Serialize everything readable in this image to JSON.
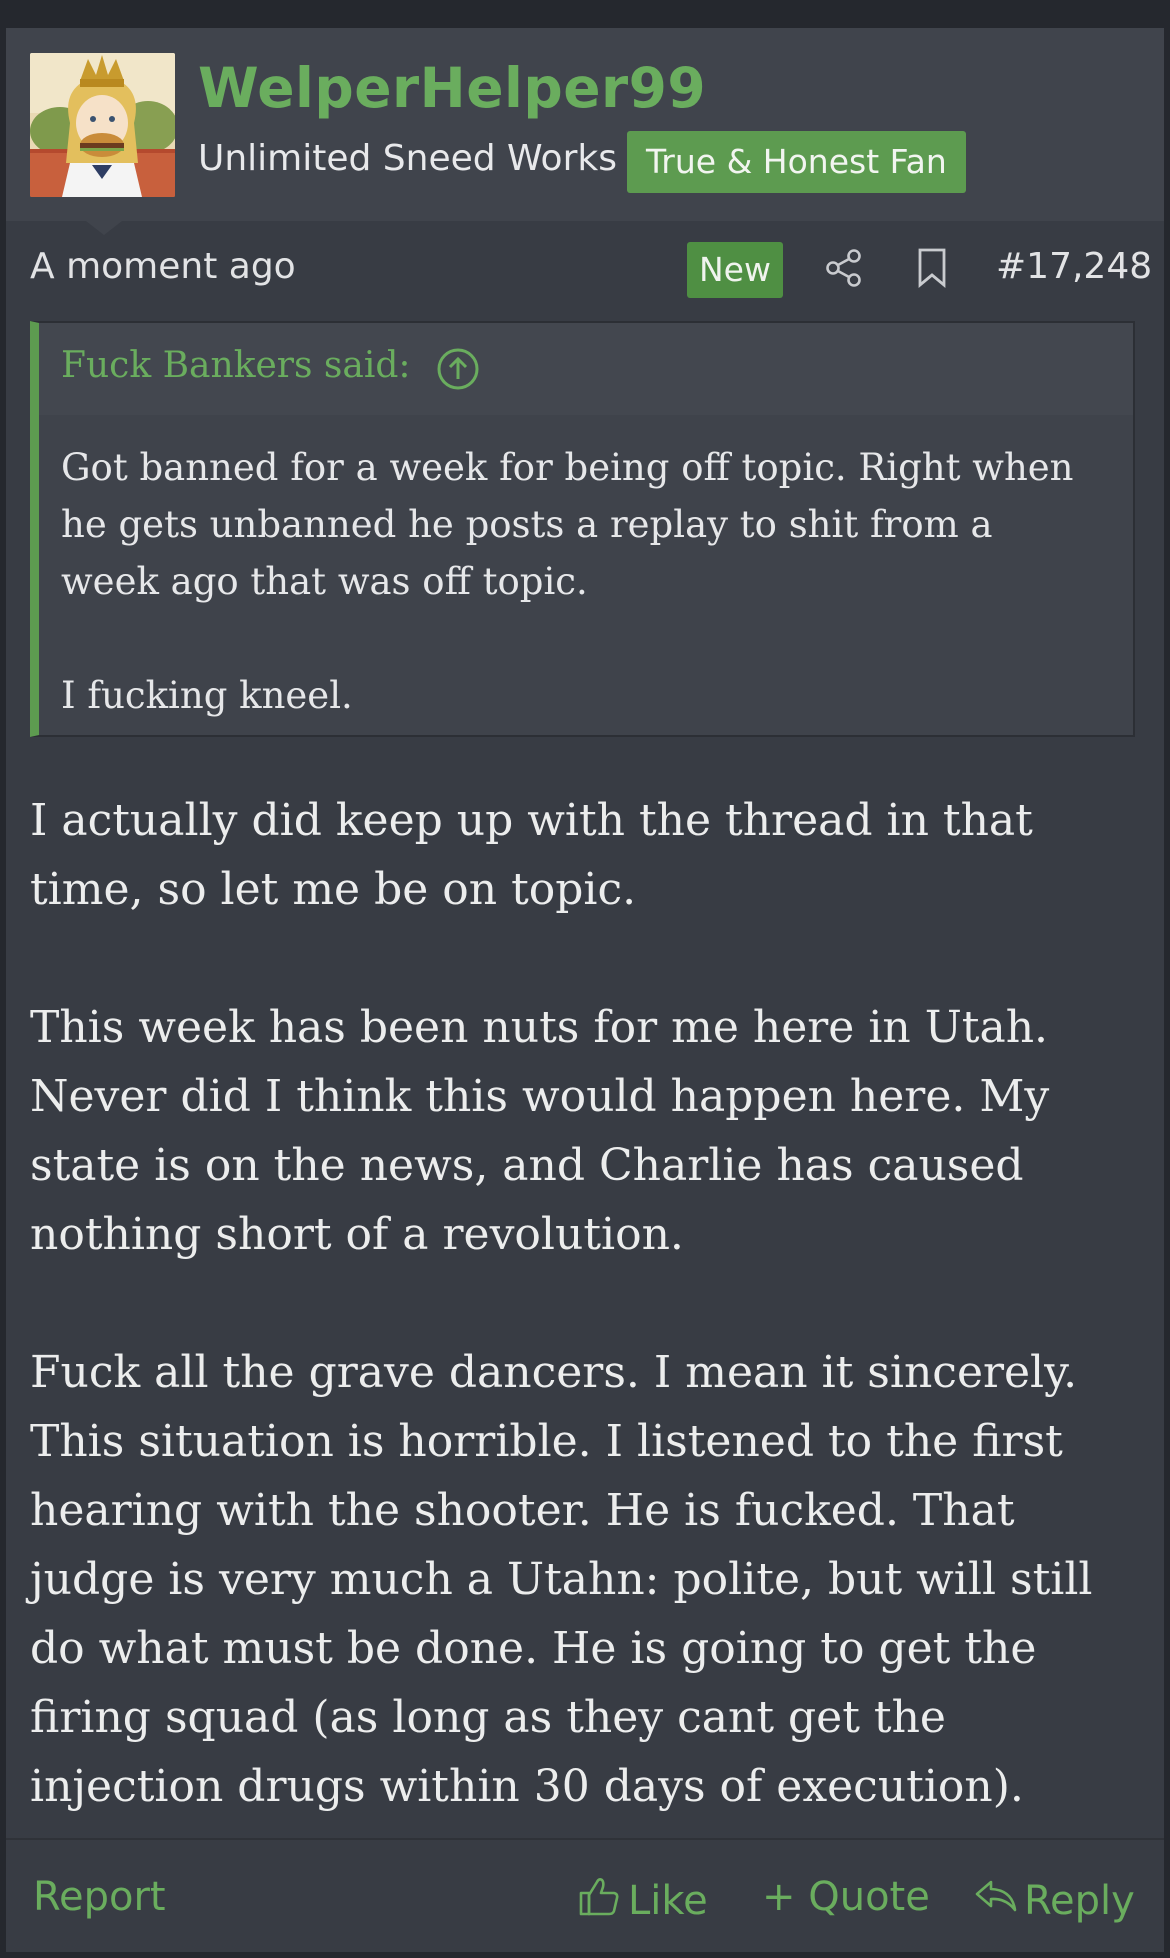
{
  "user": {
    "name": "WelperHelper99",
    "title": "Unlimited Sneed Works",
    "banner": "True & Honest Fan",
    "avatar_icon": "avatar-burger-girl"
  },
  "meta": {
    "timestamp": "A moment ago",
    "new_badge": "New",
    "post_number": "#17,248",
    "share_icon": "share-icon",
    "bookmark_icon": "bookmark-icon"
  },
  "quote": {
    "author_label": "Fuck Bankers said:",
    "body": "Got banned for a week for being off topic. Right when\nhe gets unbanned he posts a replay to shit from a\nweek ago that was off topic.\n\nI fucking kneel."
  },
  "message": {
    "paragraphs": [
      "I actually did keep up with the thread in that time, so let me be on topic.",
      "This week has been nuts for me here in Utah. Never did I think this would happen here. My state is on the news, and Charlie has caused nothing short of a revolution.",
      "Fuck all the grave dancers. I mean it sincerely. This situation is horrible. I listened to the first hearing with the shooter. He is fucked. That judge is very much a Utahn: polite, but will still do what must be done. He is going to get the firing squad (as long as they cant get the injection drugs within 30 days of execution)."
    ]
  },
  "footer": {
    "report": "Report",
    "like": "Like",
    "quote": "+ Quote",
    "reply": "Reply"
  },
  "colors": {
    "accent": "#6aad5e",
    "badge": "#5d9b50",
    "background": "#383c44"
  }
}
